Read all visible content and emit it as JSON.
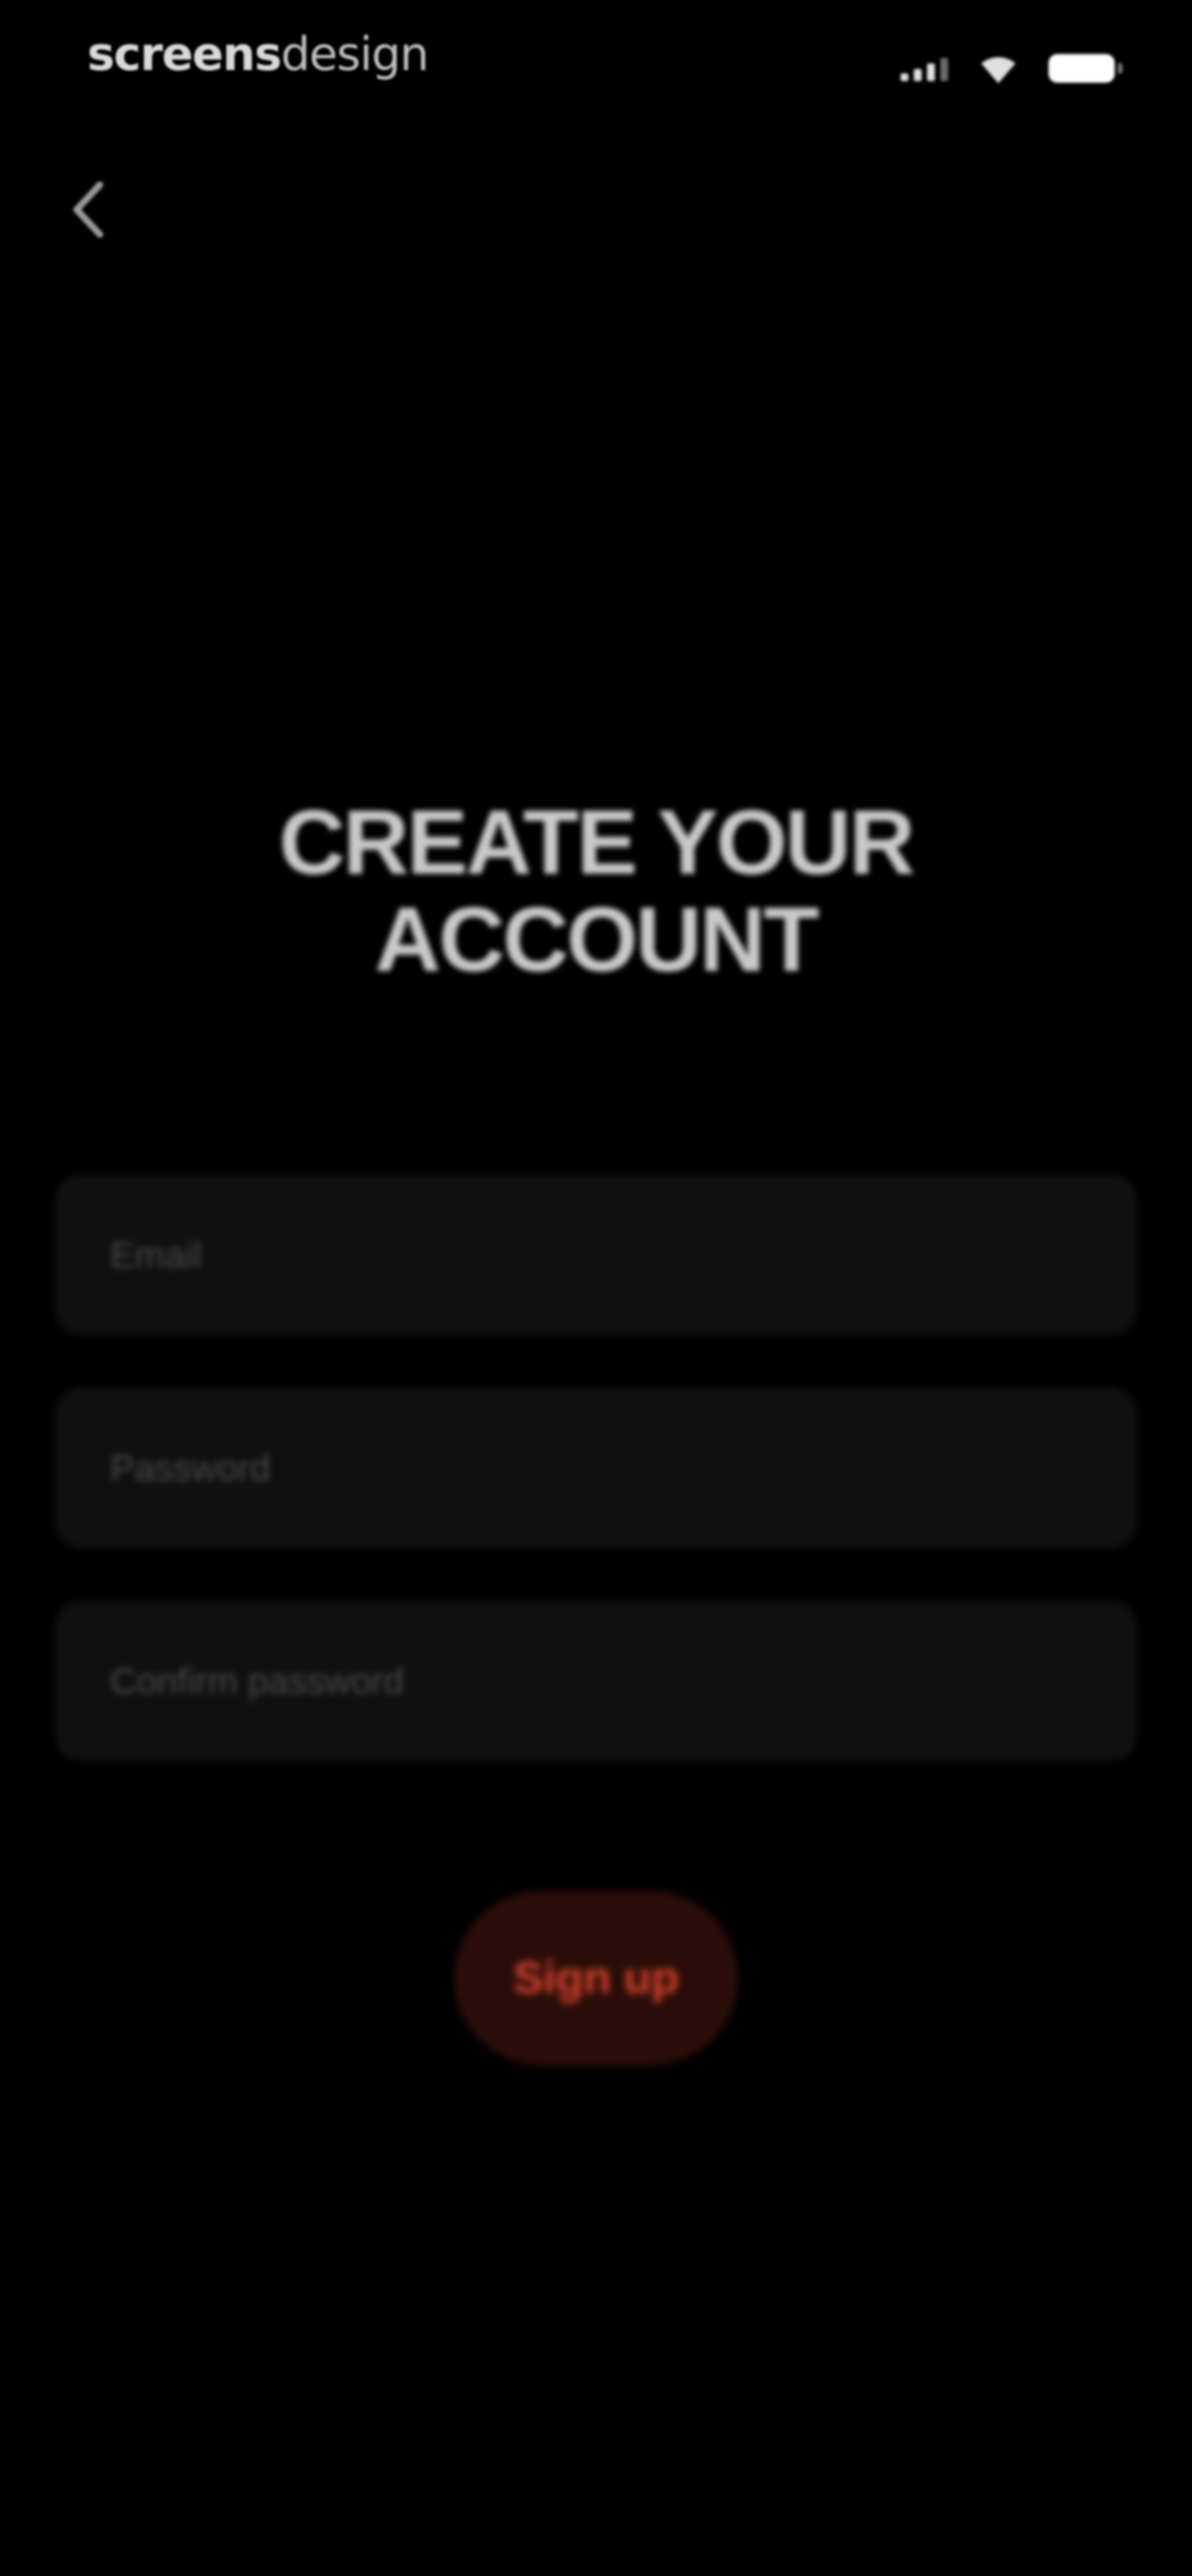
{
  "status_bar": {
    "brand_bold": "screens",
    "brand_light": "design",
    "icons": [
      "signal-icon",
      "wifi-icon",
      "battery-icon"
    ]
  },
  "navigation": {
    "back_icon": "chevron-left-icon"
  },
  "title": {
    "line1": "CREATE YOUR",
    "line2": "ACCOUNT"
  },
  "form": {
    "email_placeholder": "Email",
    "password_placeholder": "Password",
    "confirm_password_placeholder": "Confirm password",
    "email_value": "",
    "password_value": "",
    "confirm_password_value": ""
  },
  "actions": {
    "signup_label": "Sign up"
  },
  "colors": {
    "background": "#000000",
    "field_background": "#101010",
    "accent": "#d8432b",
    "accent_background": "#2a0d09",
    "title": "#c9c9c9"
  }
}
